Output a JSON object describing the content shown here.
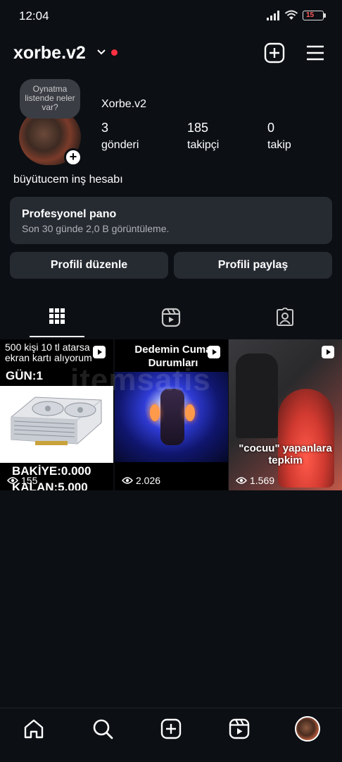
{
  "status_bar": {
    "time": "12:04",
    "battery": "15"
  },
  "header": {
    "username": "xorbe.v2"
  },
  "profile": {
    "note": "Oynatma listende neler var?",
    "display_name": "Xorbe.v2",
    "stats": [
      {
        "value": "3",
        "label": "gönderi"
      },
      {
        "value": "185",
        "label": "takipçi"
      },
      {
        "value": "0",
        "label": "takip"
      }
    ],
    "bio": "büyütucem inş hesabı"
  },
  "dashboard": {
    "title": "Profesyonel pano",
    "subtitle": "Son 30 günde 2,0 B görüntüleme."
  },
  "buttons": {
    "edit": "Profili düzenle",
    "share": "Profili paylaş"
  },
  "tabs": [
    "posts-grid-icon",
    "reels-icon",
    "tagged-icon"
  ],
  "posts": [
    {
      "top_text": "500 kişi 10 tl atarsa ekran kartı alıyorum",
      "day_text": "GÜN:1",
      "balance_text": "BAKİYE:0.000",
      "remaining_text": "KALAN:5.000",
      "views": "155"
    },
    {
      "caption": "Dedemin Cuma Durumları",
      "views": "2.026"
    },
    {
      "caption": "\"cocuu\" yapanlara tepkim",
      "views": "1.569"
    }
  ],
  "watermark": "itemsatis",
  "colors": {
    "background": "#0c0f14",
    "panel": "#262a31",
    "notification_dot": "#ff3040"
  }
}
